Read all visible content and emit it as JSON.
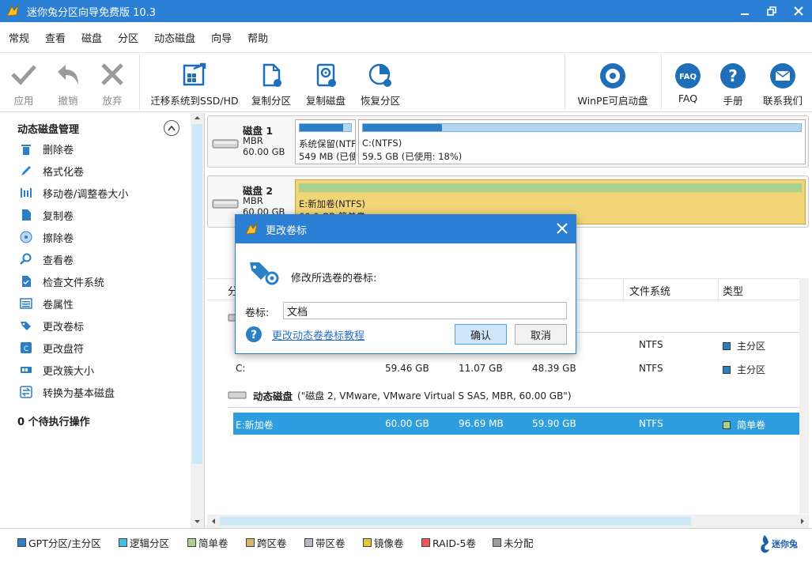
{
  "app": {
    "title": "迷你兔分区向导免费版 10.3"
  },
  "menu": [
    "常规",
    "查看",
    "磁盘",
    "分区",
    "动态磁盘",
    "向导",
    "帮助"
  ],
  "toolbar": {
    "apply": "应用",
    "undo": "撤销",
    "discard": "放弃",
    "migrate": "迁移系统到SSD/HD",
    "copy_part": "复制分区",
    "copy_disk": "复制磁盘",
    "recover": "恢复分区",
    "winpe": "WinPE可启动盘",
    "faq": "FAQ",
    "manual": "手册",
    "contact": "联系我们"
  },
  "sidebar": {
    "heading": "动态磁盘管理",
    "items": [
      {
        "label": "删除卷",
        "icon": "trash-icon"
      },
      {
        "label": "格式化卷",
        "icon": "pen-icon"
      },
      {
        "label": "移动卷/调整卷大小",
        "icon": "resize-icon"
      },
      {
        "label": "复制卷",
        "icon": "copy-icon"
      },
      {
        "label": "擦除卷",
        "icon": "wipe-icon"
      },
      {
        "label": "查看卷",
        "icon": "magnifier-icon"
      },
      {
        "label": "检查文件系统",
        "icon": "check-fs-icon"
      },
      {
        "label": "卷属性",
        "icon": "properties-icon"
      },
      {
        "label": "更改卷标",
        "icon": "label-tag-icon"
      },
      {
        "label": "更改盘符",
        "icon": "drive-letter-icon"
      },
      {
        "label": "更改簇大小",
        "icon": "cluster-icon"
      },
      {
        "label": "转换为基本磁盘",
        "icon": "convert-icon"
      }
    ],
    "pending": "0 个待执行操作"
  },
  "diskmap": {
    "disk1": {
      "name": "磁盘  1",
      "type": "MBR",
      "size": "60.00 GB",
      "parts": [
        {
          "l1": "系统保留(NTFS)",
          "l2": "549 MB (已使用",
          "used": 0.85
        },
        {
          "l1": "C:(NTFS)",
          "l2": "59.5 GB (已使用: 18%)",
          "used": 0.18
        }
      ]
    },
    "disk2": {
      "name": "磁盘  2",
      "type": "MBR",
      "size": "60.00 GB",
      "parts": [
        {
          "l1": "E:新加卷(NTFS)",
          "l2": "60.0 GB 简单卷"
        }
      ]
    }
  },
  "table": {
    "headers": {
      "partition": "分区",
      "fs": "文件系统",
      "type": "类型"
    },
    "rows": [
      {
        "name": "",
        "capacity": "",
        "used": "",
        "unused": "",
        "fs": "NTFS",
        "type": "主分区",
        "color": "#2a7fc5"
      },
      {
        "name": "C:",
        "capacity": "59.46 GB",
        "used": "11.07 GB",
        "unused": "48.39 GB",
        "fs": "NTFS",
        "type": "主分区",
        "color": "#2a7fc5"
      }
    ],
    "dynamic_disk": {
      "name": "动态磁盘",
      "desc": "(\"磁盘 2, VMware, VMware Virtual S SAS, MBR, 60.00 GB\")"
    },
    "dyn_rows": [
      {
        "name": "E:新加卷",
        "capacity": "60.00 GB",
        "used": "96.69 MB",
        "unused": "59.90 GB",
        "fs": "NTFS",
        "type": "简单卷",
        "color": "#a8d28d"
      }
    ]
  },
  "legend": [
    {
      "label": "GPT分区/主分区",
      "color": "#2a7fc5"
    },
    {
      "label": "逻辑分区",
      "color": "#3ec0e0"
    },
    {
      "label": "简单卷",
      "color": "#a8d28d"
    },
    {
      "label": "跨区卷",
      "color": "#d9b36a"
    },
    {
      "label": "带区卷",
      "color": "#b9b4c9"
    },
    {
      "label": "镜像卷",
      "color": "#e2c73a"
    },
    {
      "label": "RAID-5卷",
      "color": "#e85a5a"
    },
    {
      "label": "未分配",
      "color": "#9c9c9c"
    }
  ],
  "brand": "迷你兔",
  "dialog": {
    "title": "更改卷标",
    "prompt": "修改所选卷的卷标:",
    "label": "卷标:",
    "value": "文档",
    "help_link": "更改动态卷卷标教程",
    "ok": "确认",
    "cancel": "取消"
  }
}
